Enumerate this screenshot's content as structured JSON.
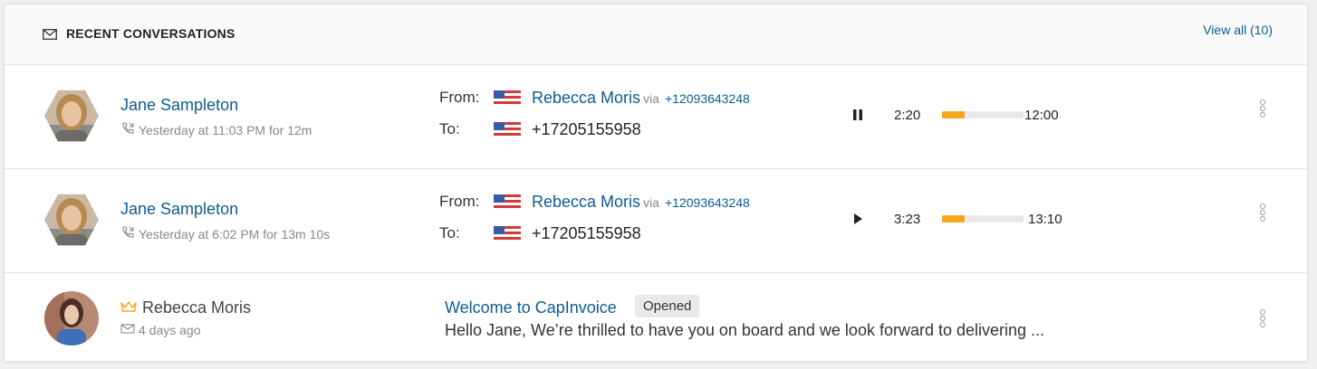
{
  "header": {
    "title": "RECENT CONVERSATIONS",
    "view_all": "View all (10)"
  },
  "colors": {
    "link": "#0d5c94",
    "progress_fill": "#f5a61a",
    "progress_track": "#e9e9e9",
    "badge_bg": "#e9e9e9"
  },
  "labels": {
    "from": "From:",
    "to": "To:",
    "via": "via"
  },
  "calls": [
    {
      "contact": "Jane Sampleton",
      "meta": "Yesterday at 11:03 PM for 12m",
      "from_name": "Rebecca Moris",
      "from_number": "+12093643248",
      "to_number": "+17205155958",
      "player_state": "pause-icon",
      "elapsed": "2:20",
      "duration": "12:00",
      "progress_fraction": 0.28
    },
    {
      "contact": "Jane Sampleton",
      "meta": "Yesterday at 6:02 PM for 13m 10s",
      "from_name": "Rebecca Moris",
      "from_number": "+12093643248",
      "to_number": "+17205155958",
      "player_state": "play-icon",
      "elapsed": "3:23",
      "duration": "13:10",
      "progress_fraction": 0.28
    }
  ],
  "email": {
    "contact": "Rebecca Moris",
    "meta": "4 days ago",
    "subject": "Welcome to CapInvoice",
    "status": "Opened",
    "preview": "Hello Jane, We’re thrilled to have you on board and we look forward to delivering ..."
  }
}
